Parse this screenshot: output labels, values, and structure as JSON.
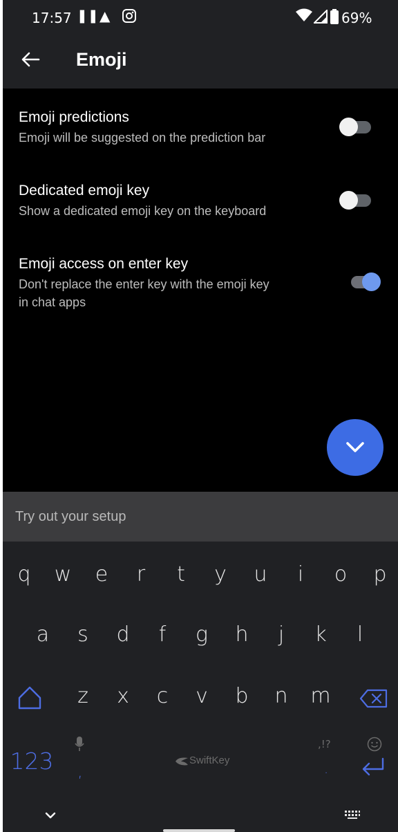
{
  "status_bar": {
    "time": "17:57",
    "battery": "69%"
  },
  "app_bar": {
    "title": "Emoji"
  },
  "settings": [
    {
      "title": "Emoji predictions",
      "desc": "Emoji will be suggested on the prediction bar",
      "enabled": false
    },
    {
      "title": "Dedicated emoji key",
      "desc": "Show a dedicated emoji key on the keyboard",
      "enabled": false
    },
    {
      "title": "Emoji access on enter key",
      "desc_line1": "Don't replace the enter key with the emoji key",
      "desc_line2": "in chat apps",
      "enabled": true
    }
  ],
  "tryout": {
    "placeholder": "Try out your setup"
  },
  "keyboard": {
    "row1": [
      "q",
      "w",
      "e",
      "r",
      "t",
      "y",
      "u",
      "i",
      "o",
      "p"
    ],
    "row2": [
      "a",
      "s",
      "d",
      "f",
      "g",
      "h",
      "j",
      "k",
      "l"
    ],
    "row3": [
      "z",
      "x",
      "c",
      "v",
      "b",
      "n",
      "m"
    ],
    "numbers_key": "123",
    "comma_key": ",",
    "period_key": ".",
    "punct_hint": ",!?",
    "brand": "SwiftKey"
  },
  "colors": {
    "accent": "#3d6ce4",
    "toggle_on_knob": "#6e99ee",
    "keyboard_bg": "#202124",
    "special_keys": "#4d6de3"
  }
}
